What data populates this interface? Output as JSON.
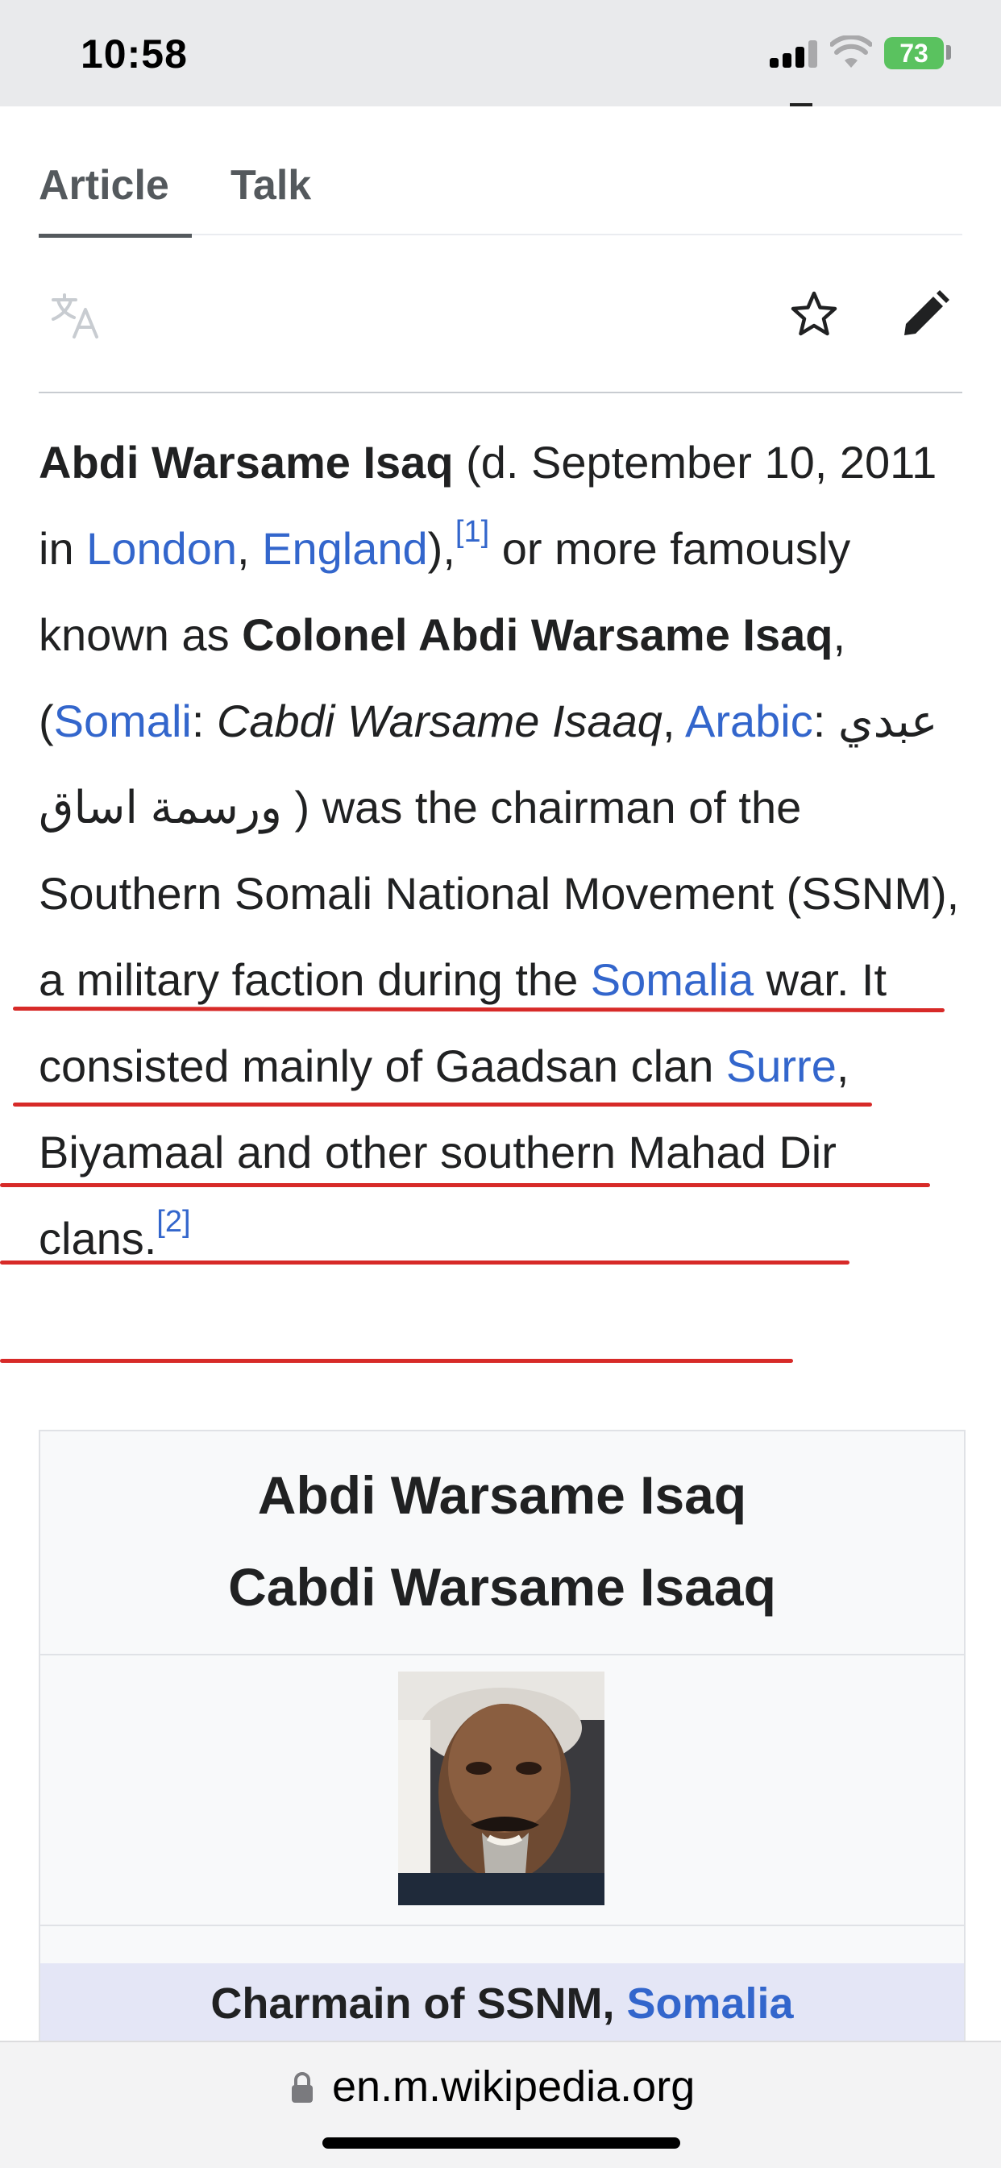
{
  "status_bar": {
    "time": "10:58",
    "battery": "73"
  },
  "tabs": [
    {
      "label": "Article"
    },
    {
      "label": "Talk"
    }
  ],
  "toolbar": {
    "icons": [
      "translate-icon",
      "star-icon",
      "pencil-icon"
    ]
  },
  "article": {
    "name_bold": "Abdi Warsame Isaq",
    "t1": " (d. September 10, 2011 in ",
    "link_london": "London",
    "t2": ", ",
    "link_england": "England",
    "t3": "),",
    "ref1": "[1]",
    "t4": " or more famously known as ",
    "colonel_bold": "Colonel Abdi Warsame Isaq",
    "t5": ", (",
    "link_somali": "Somali",
    "t6": ": ",
    "somali_name_italic": "Cabdi Warsame Isaaq",
    "t7": ", ",
    "link_arabic": "Arabic",
    "t8": ": ",
    "arabic_name": "عبدي ورسمة اساق",
    "t9": " ) was the chairman of the Southern Somali National Movement (SSNM), a military faction during the ",
    "link_somalia": "Somalia",
    "t10": " war. It consisted mainly of Gaadsan clan ",
    "link_surre": "Surre",
    "t11": ", Biyamaal and other southern Mahad Dir clans.",
    "ref2": "[2]"
  },
  "infobox": {
    "title_line1": "Abdi Warsame Isaq",
    "title_line2": "Cabdi Warsame Isaaq",
    "caption_text": "Charmain of SSNM, ",
    "caption_link": "Somalia"
  },
  "url_bar": {
    "domain": "en.m.wikipedia.org"
  },
  "colors": {
    "link": "#3366cc",
    "annotation_underline": "#d72a28",
    "battery": "#5ac25f"
  }
}
